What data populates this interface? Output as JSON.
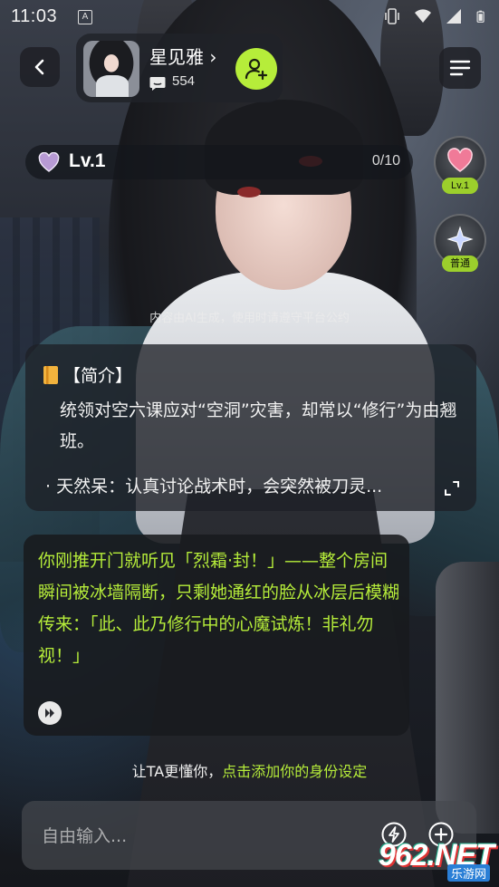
{
  "status_bar": {
    "time": "11:03",
    "notification_glyph": "A",
    "icons": [
      "vibrate-icon",
      "wifi-icon",
      "signal-icon",
      "battery-icon"
    ]
  },
  "header": {
    "character_name": "星见雅 ›",
    "message_count": "554",
    "icons": {
      "back": "back-chevron-icon",
      "follow": "add-user-icon",
      "menu": "menu-icon"
    }
  },
  "level": {
    "label": "Lv.1",
    "progress": "0/10"
  },
  "side_badges": {
    "level_badge": "Lv.1",
    "mode_badge": "普通"
  },
  "ai_notice": "内容由AI生成，使用时请遵守平台公约",
  "intro": {
    "heading": "【简介】",
    "body": "统领对空六课应对“空洞”灾害，却常以“修行”为由翘班。",
    "trait": "· 天然呆：认真讨论战术时，会突然被刀灵..."
  },
  "message": {
    "text": "你刚推开门就听见「烈霜·封！」——整个房间瞬间被冰墙隔断，只剩她通红的脸从冰层后模糊传来：「此、此乃修行中的心魔试炼！非礼勿视！」"
  },
  "identity_prompt": {
    "prefix": "让TA更懂你，",
    "link": "点击添加你的身份设定"
  },
  "input": {
    "placeholder": "自由输入..."
  },
  "watermark": {
    "main": "962.NET",
    "sub": "乐游网"
  },
  "colors": {
    "accent": "#b6ed3a",
    "badge_pill": "#9ccf2c",
    "panel": "#1e2026"
  }
}
